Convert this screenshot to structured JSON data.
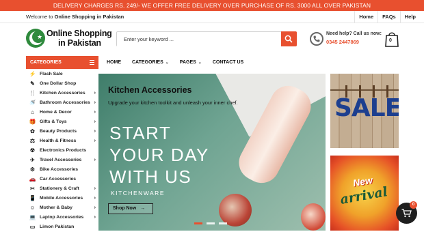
{
  "announcement": "DELIVERY CHARGES RS. 249/- WE OFFER FREE DELIVERY OVER PURCHASE OF RS. 3000 ALL OVER PAKISTAN",
  "topbar": {
    "welcome_prefix": "Welcome to",
    "welcome_site": "Online Shopping in Pakistan",
    "links": [
      "Home",
      "FAQs",
      "Help"
    ]
  },
  "header": {
    "logo_line1": "Online Shopping",
    "logo_line2": "in Pakistan",
    "search_placeholder": "Enter your keyword ...",
    "help_label": "Need help? Call us now:",
    "help_phone": "0345 2447869",
    "cart_count": "0"
  },
  "nav": {
    "categories_label": "CATEGORIES",
    "menu": [
      {
        "label": "HOME",
        "caret": ""
      },
      {
        "label": "CATEGORIES",
        "caret": "⌄"
      },
      {
        "label": "PAGES",
        "caret": "⌄"
      },
      {
        "label": "CONTACT US",
        "caret": ""
      }
    ]
  },
  "sidebar": {
    "items": [
      {
        "label": "Flash Sale",
        "icon": "⚡",
        "icon_name": "flash-icon",
        "has_arrow": false
      },
      {
        "label": "One Dollar Shop",
        "icon": "✎",
        "icon_name": "dollar-tag-icon",
        "has_arrow": false
      },
      {
        "label": "Kitchen Accessories",
        "icon": "🍴",
        "icon_name": "kitchen-icon",
        "has_arrow": true
      },
      {
        "label": "Bathroom Accessories",
        "icon": "🚿",
        "icon_name": "bathroom-icon",
        "has_arrow": true
      },
      {
        "label": "Home & Decor",
        "icon": "⌂",
        "icon_name": "home-decor-icon",
        "has_arrow": true
      },
      {
        "label": "Gifts & Toys",
        "icon": "🎁",
        "icon_name": "gift-icon",
        "has_arrow": true
      },
      {
        "label": "Beauty Products",
        "icon": "✿",
        "icon_name": "beauty-icon",
        "has_arrow": true
      },
      {
        "label": "Health & Fitness",
        "icon": "⚖",
        "icon_name": "fitness-icon",
        "has_arrow": true
      },
      {
        "label": "Electronics Products",
        "icon": "☢",
        "icon_name": "electronics-icon",
        "has_arrow": false
      },
      {
        "label": "Travel Accessories",
        "icon": "✈",
        "icon_name": "travel-icon",
        "has_arrow": true
      },
      {
        "label": "Bike Accessories",
        "icon": "⚙",
        "icon_name": "bike-icon",
        "has_arrow": false
      },
      {
        "label": "Car Accessories",
        "icon": "🚗",
        "icon_name": "car-icon",
        "has_arrow": false
      },
      {
        "label": "Stationery & Craft",
        "icon": "✂",
        "icon_name": "stationery-icon",
        "has_arrow": true
      },
      {
        "label": "Mobile Accessories",
        "icon": "📱",
        "icon_name": "mobile-icon",
        "has_arrow": true
      },
      {
        "label": "Mother & Baby",
        "icon": "☺",
        "icon_name": "baby-icon",
        "has_arrow": true
      },
      {
        "label": "Laptop Accessories",
        "icon": "💻",
        "icon_name": "laptop-icon",
        "has_arrow": true
      },
      {
        "label": "Limon Pakistan",
        "icon": "▭",
        "icon_name": "limon-icon",
        "has_arrow": false
      }
    ]
  },
  "slider": {
    "title": "Kitchen Accessories",
    "subtitle": "Upgrade your kitchen toolkit and unleash your inner chef.",
    "headline_lines": [
      "START",
      "YOUR DAY",
      "WITH US"
    ],
    "brand": "KITCHENWARE",
    "cta": "Shop Now",
    "cta_arrow": "→"
  },
  "banners": {
    "sale_text": "SALE",
    "new_text": "New",
    "arrival_text": "arrival"
  },
  "floating_cart_count": "0",
  "colors": {
    "accent": "#e8502f",
    "logo_green": "#2f8a3d",
    "sale_blue": "#1d3f8f"
  }
}
